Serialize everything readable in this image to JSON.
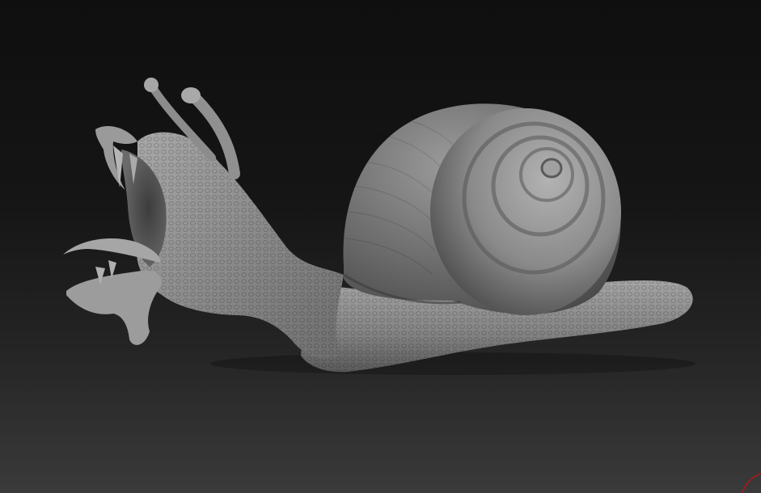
{
  "viewport": {
    "background_top": "#0f0f0f",
    "background_bottom": "#3a3a3a",
    "model_color": "#8e8e8e",
    "gizmo_color": "#b01818"
  },
  "model": {
    "icon": "snail-sculpt-icon"
  },
  "gizmo": {
    "icon": "axis-gizmo-icon"
  }
}
